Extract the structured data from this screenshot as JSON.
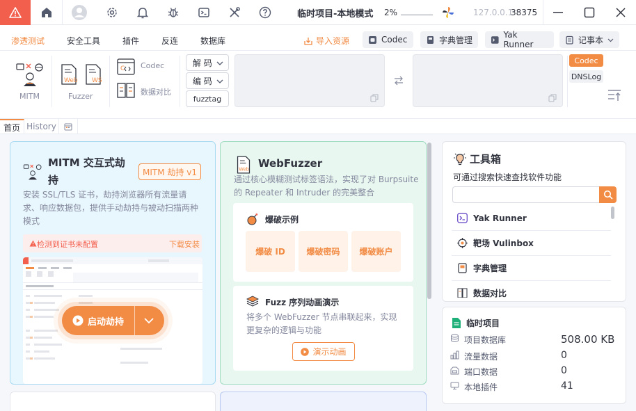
{
  "titlebar": {
    "project_title": "临时项目-本地模式",
    "progress_percent": "2%",
    "host": "127.0.0.1",
    "port": "38375"
  },
  "menu": {
    "items": [
      "渗透测试",
      "安全工具",
      "插件",
      "反连",
      "数据库"
    ],
    "import_label": "导入资源",
    "pills": [
      "Codec",
      "字典管理",
      "Yak Runner",
      "记事本"
    ]
  },
  "tools": {
    "mitm_label": "MITM",
    "fuzzer_label": "Fuzzer",
    "codec_label": "Codec",
    "compare_label": "数据对比",
    "decode_label": "解 码",
    "encode_label": "编 码",
    "fuzztag_label": "fuzztag",
    "side_codec": "Codec",
    "side_dnslog": "DNSLog",
    "web_tag": "Web",
    "ws_tag": "WS"
  },
  "tabs": {
    "home": "首页",
    "history": "History"
  },
  "mitm_card": {
    "title_line1": "MITM 交互式劫",
    "title_line2": "持",
    "badge": "MITM 劫持 v1",
    "desc_line1": "安装 SSL/TLS 证书，劫持浏览器所有流量请",
    "desc_line2": "求、响应数据包，提供手动劫持与被动扫描两种",
    "desc_line3": "模式",
    "cert_warning": "检测到证书未配置",
    "download_install": "下载安装",
    "start_button": "启动劫持"
  },
  "webfuzzer_card": {
    "title": "WebFuzzer",
    "desc_line1": "通过核心模糊测试标签语法，实现了对 Burpsuite",
    "desc_line2": "的 Repeater 和 Intruder 的完美整合",
    "burst_title": "爆破示例",
    "burst_items": [
      "爆破 ID",
      "爆破密码",
      "爆破账户"
    ],
    "seq_title": "Fuzz 序列动画演示",
    "seq_desc_line1": "将多个 WebFuzzer 节点串联起来，实现",
    "seq_desc_line2": "更复杂的逻辑与功能",
    "demo_button": "演示动画"
  },
  "toolbox": {
    "title": "工具箱",
    "subtitle": "可通过搜索快速查找软件功能",
    "search_placeholder": "",
    "items": [
      "Yak Runner",
      "靶场 Vulinbox",
      "字典管理",
      "数据对比"
    ]
  },
  "project_panel": {
    "title": "临时项目",
    "stats": [
      {
        "label": "项目数据库",
        "value": "508.00 KB"
      },
      {
        "label": "流量数据",
        "value": "0"
      },
      {
        "label": "端口数据",
        "value": "0"
      },
      {
        "label": "本地插件",
        "value": "41"
      }
    ]
  },
  "colors": {
    "accent": "#f28b44",
    "warning_tab": "#f25f4c",
    "mitm_bg": "#e8f6fd",
    "webfuzzer_bg": "#e8f7f0"
  }
}
